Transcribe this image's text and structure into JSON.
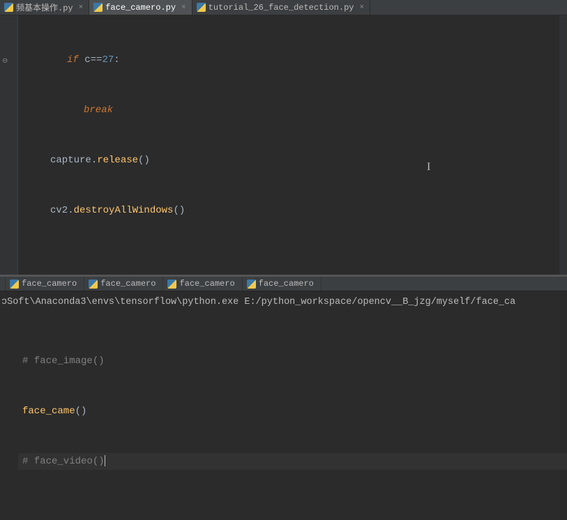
{
  "tabs": [
    {
      "label": "频基本操作.py",
      "active": false
    },
    {
      "label": "face_camero.py",
      "active": true
    },
    {
      "label": "tutorial_26_face_detection.py",
      "active": false
    }
  ],
  "code": {
    "l1_kw": "if",
    "l1_var": " c",
    "l1_op": "==",
    "l1_num": "27",
    "l1_colon": ":",
    "l2_kw": "break",
    "l3_a": "capture.",
    "l3_fn": "release",
    "l3_par": "()",
    "l4_a": "cv2.",
    "l4_fn": "destroyAllWindows",
    "l4_par": "()",
    "l5_cmt": "# face_image()",
    "l6_fn": "face_came",
    "l6_par": "()",
    "l7_cmt": "# face_video()"
  },
  "run_tabs": [
    {
      "label": "face_camero"
    },
    {
      "label": "face_camero"
    },
    {
      "label": "face_camero"
    },
    {
      "label": "face_camero"
    }
  ],
  "console_line": "ɔSoft\\Anaconda3\\envs\\tensorflow\\python.exe E:/python_workspace/opencv__B_jzg/myself/face_ca"
}
